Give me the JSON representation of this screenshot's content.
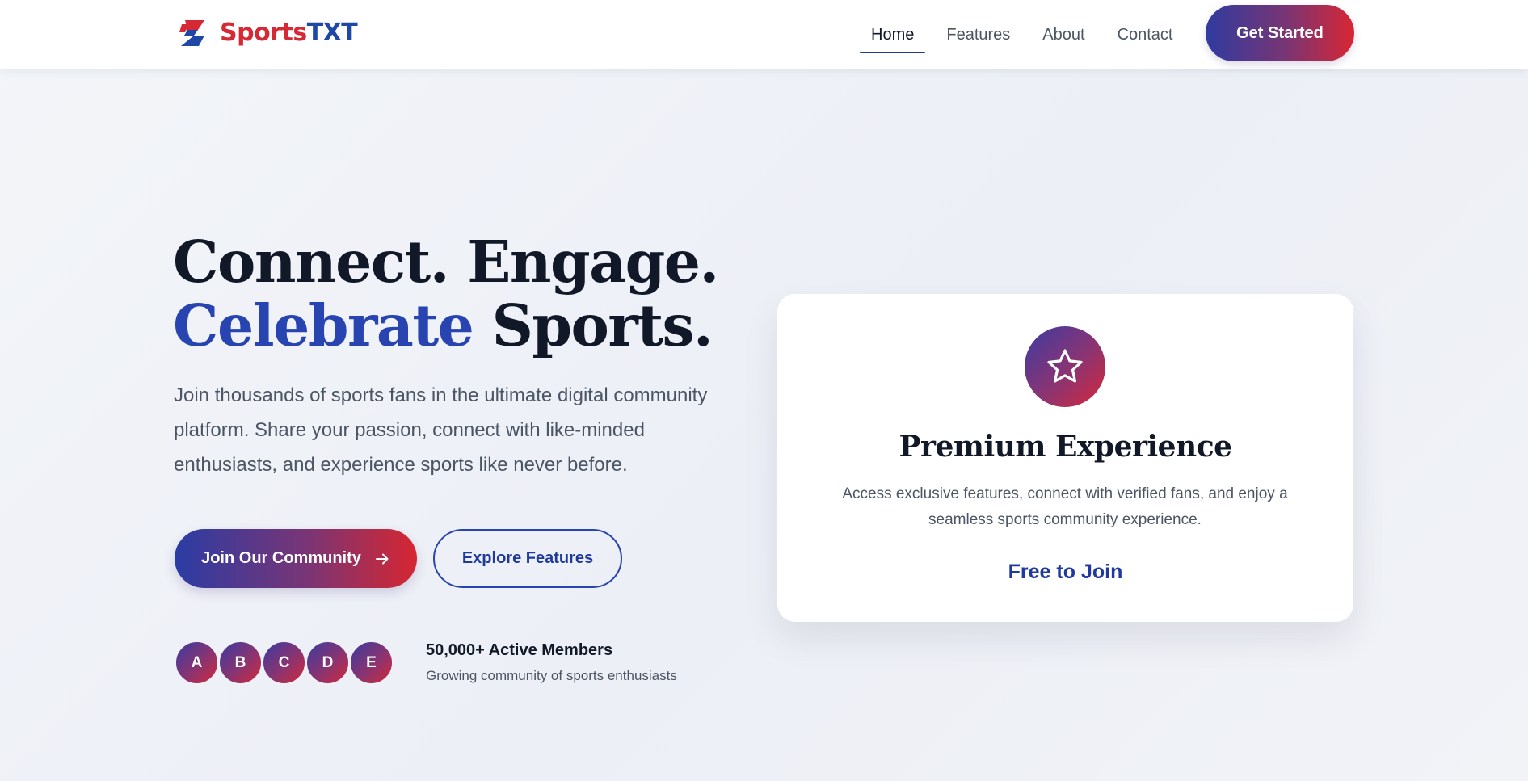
{
  "navbar": {
    "brand": {
      "part1": "Sports",
      "part2": "TXT",
      "logo_icon": "lightning-bolt-icon"
    },
    "links": [
      {
        "label": "Home",
        "active": true
      },
      {
        "label": "Features",
        "active": false
      },
      {
        "label": "About",
        "active": false
      },
      {
        "label": "Contact",
        "active": false
      }
    ],
    "cta_label": "Get Started"
  },
  "hero": {
    "title_line1": "Connect. Engage.",
    "title_accent": "Celebrate",
    "title_rest": " Sports.",
    "description": "Join thousands of sports fans in the ultimate digital community platform. Share your passion, connect with like-minded enthusiasts, and experience sports like never before.",
    "primary_button": {
      "label": "Join Our Community",
      "icon": "arrow-right-icon"
    },
    "secondary_button": {
      "label": "Explore Features"
    },
    "avatars": [
      "A",
      "B",
      "C",
      "D",
      "E"
    ],
    "members_title": "50,000+ Active Members",
    "members_subtitle": "Growing community of sports enthusiasts"
  },
  "card": {
    "icon": "star-icon",
    "title": "Premium Experience",
    "description": "Access exclusive features, connect with verified fans, and enjoy a seamless sports community experience.",
    "cta": "Free to Join"
  },
  "colors": {
    "brand_red": "#d62936",
    "brand_blue": "#1f47a6",
    "accent_blue": "#2744b0",
    "gradient_start": "#2f3ba0",
    "gradient_end": "#d92633",
    "text_dark": "#111827",
    "text_muted": "#4b5563"
  }
}
